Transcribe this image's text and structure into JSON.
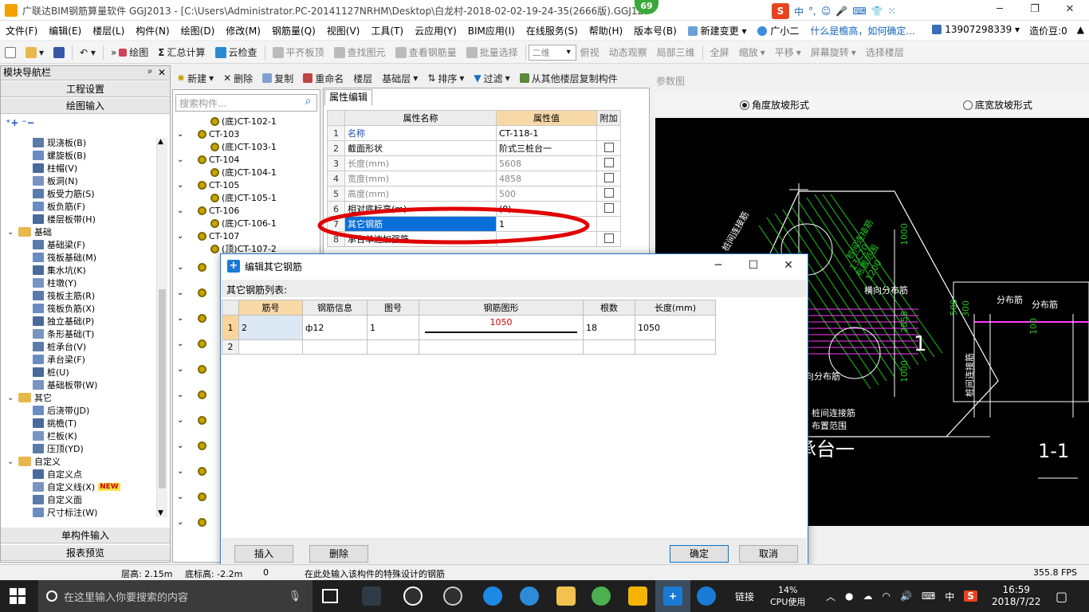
{
  "titlebar": {
    "title": "广联达BIM钢筋算量软件 GGJ2013 - [C:\\Users\\Administrator.PC-20141127NRHM\\Desktop\\白龙村-2018-02-02-19-24-35(2666版).GGJ12",
    "badge": "69",
    "ime": [
      "中",
      "°,",
      "☺",
      "🎤",
      "⌨",
      "👕",
      "⁙"
    ]
  },
  "menubar": {
    "items": [
      "文件(F)",
      "编辑(E)",
      "楼层(L)",
      "构件(N)",
      "绘图(D)",
      "修改(M)",
      "钢筋量(Q)",
      "视图(V)",
      "工具(T)",
      "云应用(Y)",
      "BIM应用(I)",
      "在线服务(S)",
      "帮助(H)",
      "版本号(B)",
      "新建变更",
      "广小二"
    ],
    "question": "什么是檐高，如何确定...",
    "phone": "13907298339",
    "beans": "造价豆:0"
  },
  "toolbar1": {
    "items": [
      "绘图",
      "汇总计算",
      "云检查",
      "平齐板顶",
      "查找图元",
      "查看钢筋量",
      "批量选择"
    ],
    "view_mode": "二维",
    "view_items": [
      "俯视",
      "动态观察",
      "局部三维",
      "全屏",
      "缩放",
      "平移",
      "屏幕旋转",
      "选择楼层"
    ]
  },
  "leftnav": {
    "header": "模块导航栏",
    "btn_project": "工程设置",
    "btn_draw": "绘图输入",
    "btn_single": "单构件输入",
    "btn_report": "报表预览",
    "tree": [
      {
        "label": "现浇板(B)",
        "level": 2
      },
      {
        "label": "螺旋板(B)",
        "level": 2
      },
      {
        "label": "柱帽(V)",
        "level": 2
      },
      {
        "label": "板洞(N)",
        "level": 2
      },
      {
        "label": "板受力筋(S)",
        "level": 2
      },
      {
        "label": "板负筋(F)",
        "level": 2
      },
      {
        "label": "楼层板带(H)",
        "level": 2
      },
      {
        "label": "基础",
        "level": 1
      },
      {
        "label": "基础梁(F)",
        "level": 2
      },
      {
        "label": "筏板基础(M)",
        "level": 2
      },
      {
        "label": "集水坑(K)",
        "level": 2
      },
      {
        "label": "柱墩(Y)",
        "level": 2
      },
      {
        "label": "筏板主筋(R)",
        "level": 2
      },
      {
        "label": "筏板负筋(X)",
        "level": 2
      },
      {
        "label": "独立基础(P)",
        "level": 2
      },
      {
        "label": "条形基础(T)",
        "level": 2
      },
      {
        "label": "桩承台(V)",
        "level": 2
      },
      {
        "label": "承台梁(F)",
        "level": 2
      },
      {
        "label": "桩(U)",
        "level": 2
      },
      {
        "label": "基础板带(W)",
        "level": 2
      },
      {
        "label": "其它",
        "level": 1
      },
      {
        "label": "后浇带(JD)",
        "level": 2
      },
      {
        "label": "挑檐(T)",
        "level": 2
      },
      {
        "label": "栏板(K)",
        "level": 2
      },
      {
        "label": "压顶(YD)",
        "level": 2
      },
      {
        "label": "自定义",
        "level": 1
      },
      {
        "label": "自定义点",
        "level": 2
      },
      {
        "label": "自定义线(X)",
        "level": 2
      },
      {
        "label": "自定义面",
        "level": 2
      },
      {
        "label": "尺寸标注(W)",
        "level": 2
      }
    ],
    "new_badge": "NEW"
  },
  "midpanel": {
    "toolbar": [
      "新建",
      "删除",
      "复制",
      "重命名",
      "楼层",
      "基础层",
      "排序",
      "过滤",
      "从其他楼层复制构件"
    ],
    "search_placeholder": "搜索构件...",
    "items": [
      {
        "label": "(底)CT-102-1",
        "child": true
      },
      {
        "label": "CT-103",
        "child": false
      },
      {
        "label": "(底)CT-103-1",
        "child": true
      },
      {
        "label": "CT-104",
        "child": false
      },
      {
        "label": "(底)CT-104-1",
        "child": true
      },
      {
        "label": "CT-105",
        "child": false
      },
      {
        "label": "(底)CT-105-1",
        "child": true
      },
      {
        "label": "CT-106",
        "child": false
      },
      {
        "label": "(底)CT-106-1",
        "child": true
      },
      {
        "label": "CT-107",
        "child": false
      },
      {
        "label": "(顶)CT-107-2",
        "child": true
      }
    ]
  },
  "props": {
    "tab": "属性编辑",
    "col_name": "属性名称",
    "col_value": "属性值",
    "col_extra": "附加",
    "rows": [
      {
        "n": "1",
        "name": "名称",
        "value": "CT-118-1",
        "style": "blue",
        "check": false
      },
      {
        "n": "2",
        "name": "截面形状",
        "value": "阶式三桩台一",
        "style": "",
        "check": true
      },
      {
        "n": "3",
        "name": "长度(mm)",
        "value": "5608",
        "style": "gray",
        "check": true
      },
      {
        "n": "4",
        "name": "宽度(mm)",
        "value": "4858",
        "style": "gray",
        "check": true
      },
      {
        "n": "5",
        "name": "高度(mm)",
        "value": "500",
        "style": "gray",
        "check": true
      },
      {
        "n": "6",
        "name": "相对底标高(m)",
        "value": "(0)",
        "style": "",
        "check": true
      },
      {
        "n": "7",
        "name": "其它钢筋",
        "value": "1",
        "style": "sel",
        "check": false
      },
      {
        "n": "8",
        "name": "承台单边加强筋",
        "value": "",
        "style": "",
        "check": true
      }
    ]
  },
  "param": {
    "header": "参数图",
    "radio1": "角度放坡形式",
    "radio2": "底宽放坡形式",
    "radio1_checked": true,
    "drawing": {
      "labels_green": [
        "桩间连接筋",
        "13C20",
        "布置范围",
        "1200",
        "1000",
        "2858",
        "1000",
        "500",
        "300",
        "100"
      ],
      "labels_white": [
        "横向分布筋",
        "分布筋",
        "分布筋",
        "向分布筋",
        "桩间连接筋",
        "布置范围",
        "桩间连接筋",
        "1",
        "承台一",
        "1-1"
      ]
    }
  },
  "dialog": {
    "title": "编辑其它钢筋",
    "subtitle": "其它钢筋列表:",
    "columns": [
      "筋号",
      "钢筋信息",
      "图号",
      "钢筋图形",
      "根数",
      "长度(mm)"
    ],
    "rows": [
      {
        "n": "1",
        "bar_no": "2",
        "info": "ф12",
        "fig": "1",
        "shape_len": "1050",
        "count": "18",
        "length": "1050"
      },
      {
        "n": "2",
        "bar_no": "",
        "info": "",
        "fig": "",
        "shape_len": "",
        "count": "",
        "length": ""
      }
    ],
    "btn_insert": "插入",
    "btn_delete": "删除",
    "btn_ok": "确定",
    "btn_cancel": "取消"
  },
  "status": {
    "floor_height": "层高: 2.15m",
    "bottom_elev": "底标高: -2.2m",
    "zero": "0",
    "hint": "在此处输入该构件的特殊设计的钢筋",
    "fps": "355.8 FPS"
  },
  "taskbar": {
    "search_placeholder": "在这里输入你要搜索的内容",
    "link": "链接",
    "cpu_percent": "14%",
    "cpu_label": "CPU使用",
    "lang": "中",
    "time": "16:59",
    "date": "2018/7/22"
  },
  "colors": {
    "accent": "#0a6fd8",
    "header_highlight": "#f7d9a8",
    "drawing_green": "#22c322",
    "drawing_magenta": "#ff3cff",
    "annotation_red": "#e00000"
  }
}
